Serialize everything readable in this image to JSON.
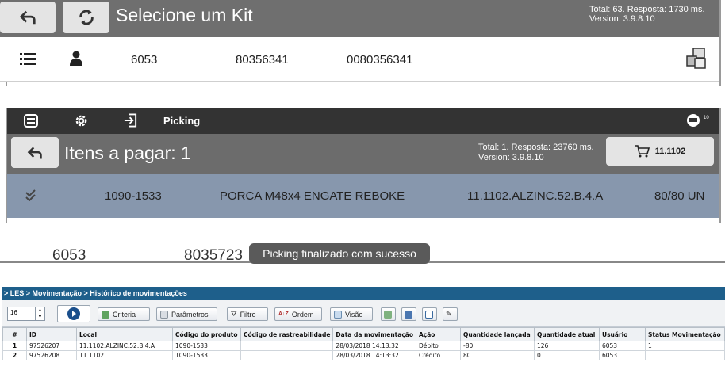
{
  "kit_screen": {
    "title": "Selecione um Kit",
    "status_line1": "Total: 63. Resposta: 1730 ms.",
    "status_line2": "Version: 3.9.8.10",
    "row": {
      "col1": "6053",
      "col2": "80356341",
      "col3": "0080356341"
    }
  },
  "picking_screen": {
    "header_label": "Picking",
    "notification_count": "10",
    "title": "Itens a pagar: 1",
    "status_line1": "Total: 1. Resposta: 23760 ms.",
    "status_line2": "Version: 3.9.8.10",
    "cart_label": "11.1102",
    "item": {
      "code": "1090-1533",
      "description": "PORCA M48x4 ENGATE REBOKE",
      "location": "11.1102.ALZINC.52.B.4.A",
      "quantity": "80/80 UN"
    }
  },
  "partial_screen": {
    "text1": "6053",
    "text2": "8035723",
    "toast": "Picking finalizado com sucesso"
  },
  "les": {
    "breadcrumb": "> LES > Movimentação > Histórico de movimentações",
    "page_size": "16",
    "buttons": {
      "criteria": "Criteria",
      "parametros": "Parâmetros",
      "filtro": "Filtro",
      "ordem": "Ordem",
      "visao": "Visão"
    },
    "columns": [
      "#",
      "ID",
      "Local",
      "Código do produto",
      "Código de rastreabilidade",
      "Data da movimentação",
      "Ação",
      "Quantidade lançada",
      "Quantidade atual",
      "Usuário",
      "Status Movimentação"
    ],
    "rows": [
      [
        "1",
        "97526207",
        "11.1102.ALZINC.52.B.4.A",
        "1090-1533",
        "",
        "28/03/2018 14:13:32",
        "Débito",
        "-80",
        "126",
        "6053",
        "1"
      ],
      [
        "2",
        "97526208",
        "11.1102",
        "1090-1533",
        "",
        "28/03/2018 14:13:32",
        "Crédito",
        "80",
        "0",
        "6053",
        "1"
      ]
    ]
  },
  "colors": {
    "dark_bar": "#333333",
    "grey_bar": "#6f6f6f",
    "selected_row": "#8797ad",
    "les_header": "#1e5f8b"
  }
}
